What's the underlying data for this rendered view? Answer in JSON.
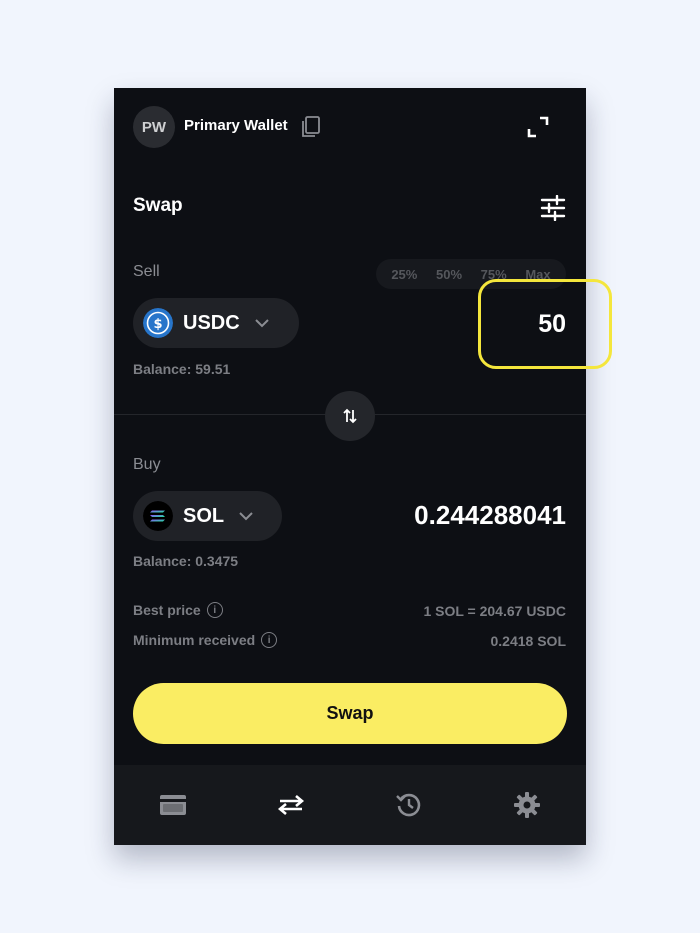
{
  "header": {
    "avatar_initials": "PW",
    "wallet_name": "Primary Wallet",
    "icons": [
      "copy-icon",
      "expand-icon"
    ]
  },
  "swap": {
    "title": "Swap",
    "settings_icon": "sliders-icon"
  },
  "sell": {
    "label": "Sell",
    "percent_options": [
      "25%",
      "50%",
      "75%",
      "Max"
    ],
    "token": "USDC",
    "token_icon": "usdc-icon",
    "amount": "50",
    "balance": "Balance: 59.51"
  },
  "buy": {
    "label": "Buy",
    "token": "SOL",
    "token_icon": "sol-icon",
    "amount": "0.244288041",
    "balance": "Balance: 0.3475"
  },
  "details": {
    "best_price_label": "Best price",
    "best_price_value": "1 SOL = 204.67 USDC",
    "min_received_label": "Minimum received",
    "min_received_value": "0.2418 SOL"
  },
  "actions": {
    "swap_button": "Swap"
  },
  "nav": {
    "items": [
      "wallet-icon",
      "swap-arrows-icon",
      "history-icon",
      "gear-icon"
    ],
    "active": "swap-arrows-icon"
  },
  "colors": {
    "panel_bg": "#0d0f14",
    "accent_yellow": "#faed63",
    "highlight_border": "#f4e63c",
    "muted_text": "#7c7e84"
  }
}
